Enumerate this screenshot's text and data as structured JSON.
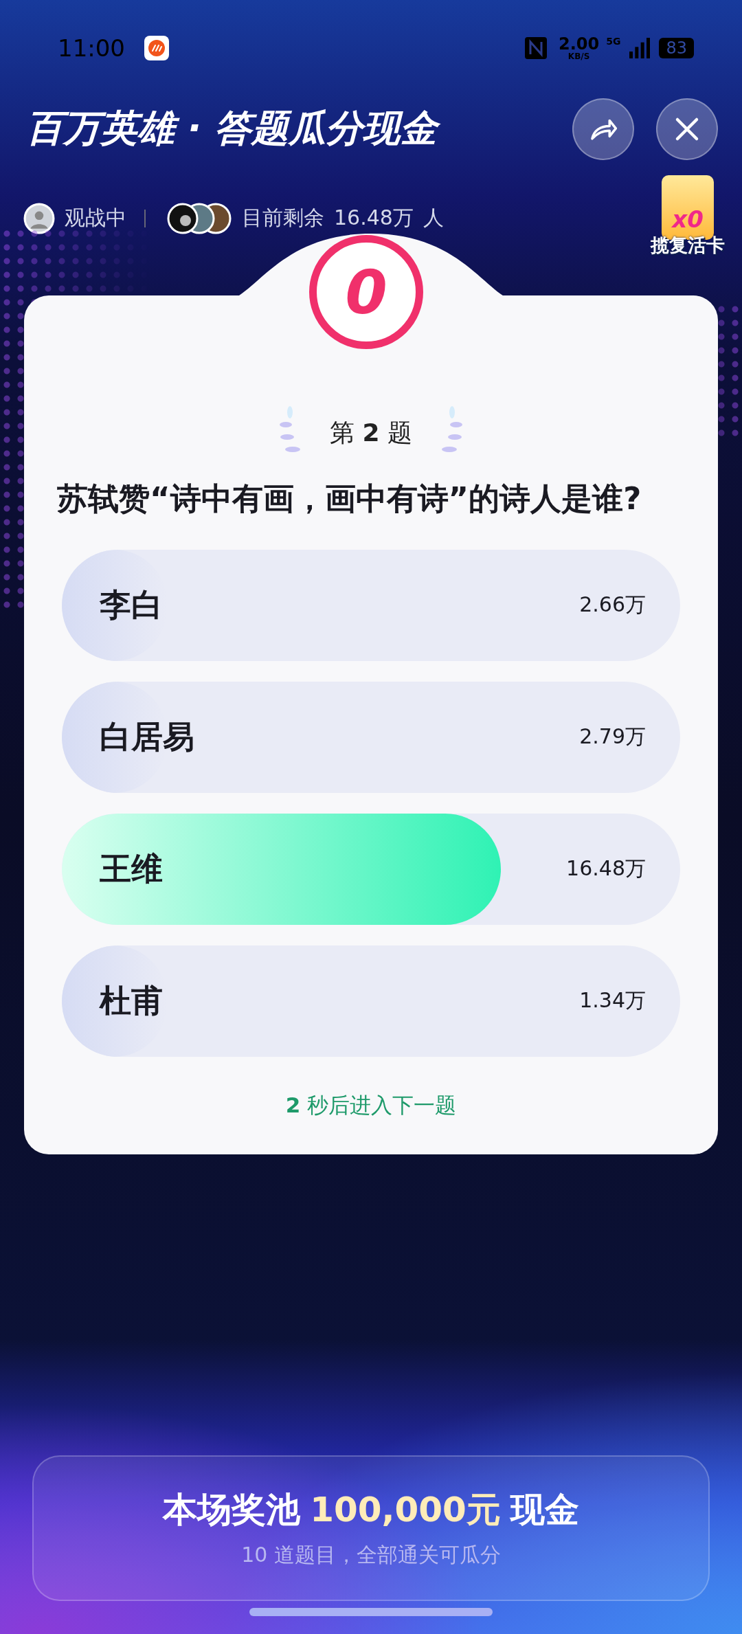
{
  "status_bar": {
    "time": "11:00",
    "speed": "2.00",
    "speed_unit": "KB/S",
    "network": "5G",
    "battery": "83"
  },
  "header": {
    "title": "百万英雄 · 答题瓜分现金",
    "watching": "观战中",
    "remaining_label": "目前剩余",
    "remaining_count": "16.48万",
    "remaining_unit": "人"
  },
  "revival_card": {
    "count": "x0",
    "label": "揽复活卡"
  },
  "timer": "0",
  "question": {
    "number_prefix": "第",
    "number": "2",
    "number_suffix": "题",
    "text": "苏轼赞“诗中有画，画中有诗”的诗人是谁?"
  },
  "options": [
    {
      "label": "李白",
      "count": "2.66万",
      "level": 0.17,
      "correct": false
    },
    {
      "label": "白居易",
      "count": "2.79万",
      "level": 0.17,
      "correct": false
    },
    {
      "label": "王维",
      "count": "16.48万",
      "level": 0.71,
      "correct": true
    },
    {
      "label": "杜甫",
      "count": "1.34万",
      "level": 0.17,
      "correct": false
    }
  ],
  "next_hint": "**2** 秒后进入下一题",
  "prize": {
    "prefix": "本场奖池",
    "amount": "100,000元",
    "suffix": "现金",
    "note": "10 道题目，全部通关可瓜分"
  }
}
